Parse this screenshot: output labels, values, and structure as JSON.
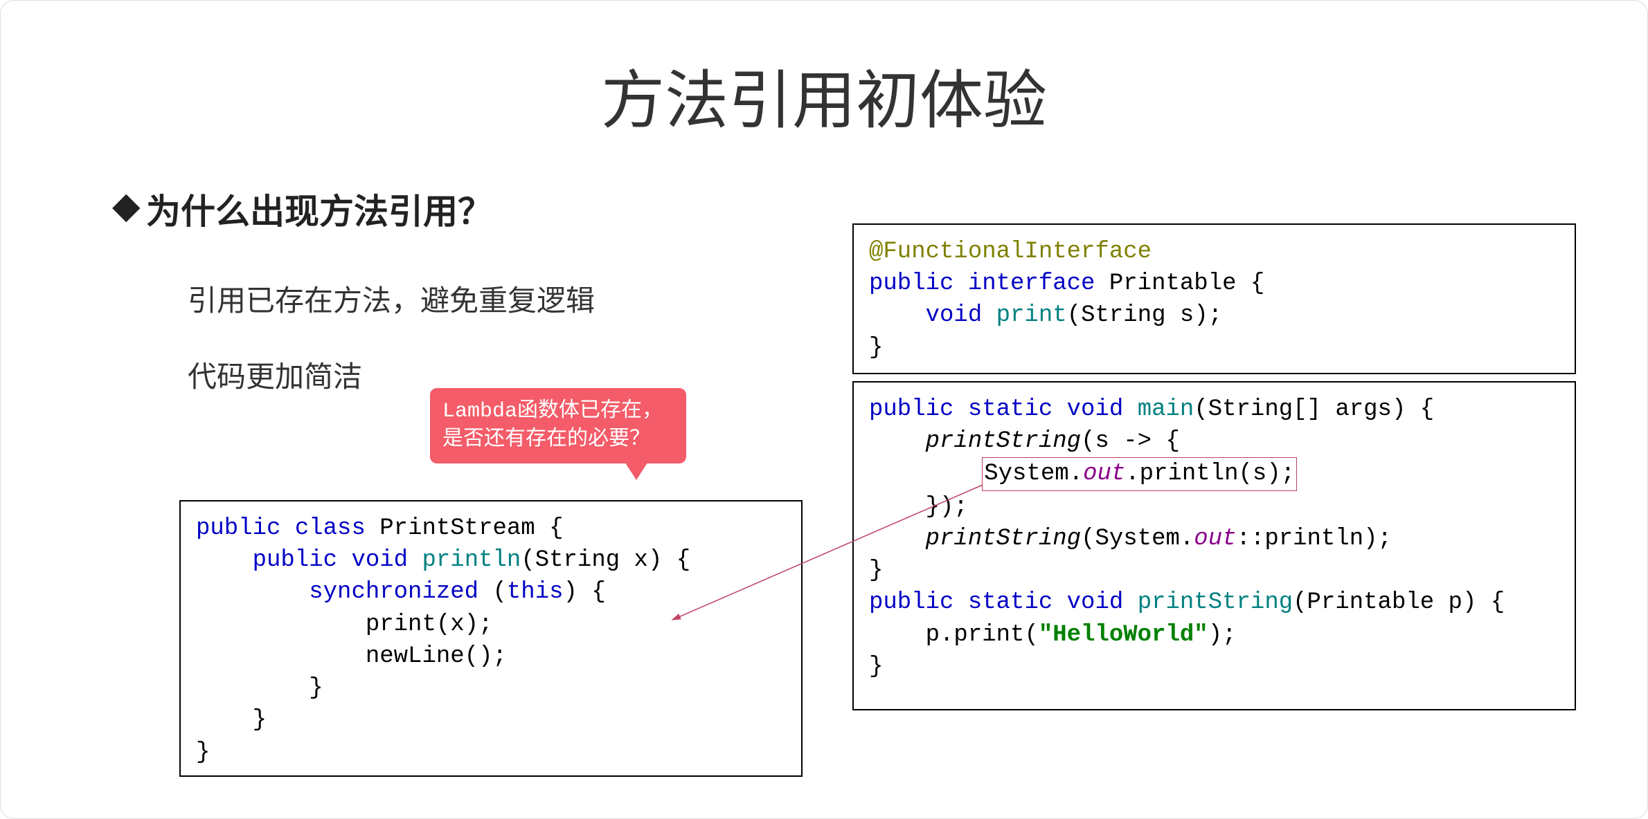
{
  "title": "方法引用初体验",
  "subtitle": "为什么出现方法引用？",
  "points": {
    "p1": "引用已存在方法，避免重复逻辑",
    "p2": "代码更加简洁"
  },
  "callout": {
    "line1": "Lambda函数体已存在，",
    "line2": "是否还有存在的必要？"
  },
  "code_left": {
    "l1a": "public",
    "l1b": "class",
    "l1c": "PrintStream",
    "l1d": " {",
    "l2a": "public",
    "l2b": "void",
    "l2c": "println",
    "l2d": "(String x) {",
    "l3a": "synchronized",
    "l3b": "(",
    "l3c": "this",
    "l3d": ") {",
    "l4": "print(x);",
    "l5": "newLine();",
    "l6": "}",
    "l7": "}",
    "l8": "}"
  },
  "code_top": {
    "l1": "@FunctionalInterface",
    "l2a": "public",
    "l2b": "interface",
    "l2c": "Printable",
    "l2d": " {",
    "l3a": "void",
    "l3b": "print",
    "l3c": "(String s);",
    "l4": "}"
  },
  "code_bottom": {
    "l1a": "public",
    "l1b": "static",
    "l1c": "void",
    "l1d": "main",
    "l1e": "(String[] args) {",
    "l2a": "printString",
    "l2b": "(s -> {",
    "l3a": "System.",
    "l3b": "out",
    "l3c": ".println(s);",
    "l4": "});",
    "l5a": "printString",
    "l5b": "(System.",
    "l5c": "out",
    "l5d": "::println);",
    "l6": "}",
    "l7a": "public",
    "l7b": "static",
    "l7c": "void",
    "l7d": "printString",
    "l7e": "(Printable p) {",
    "l8a": "p.print(",
    "l8b": "\"HelloWorld\"",
    "l8c": ");",
    "l9": "}"
  }
}
